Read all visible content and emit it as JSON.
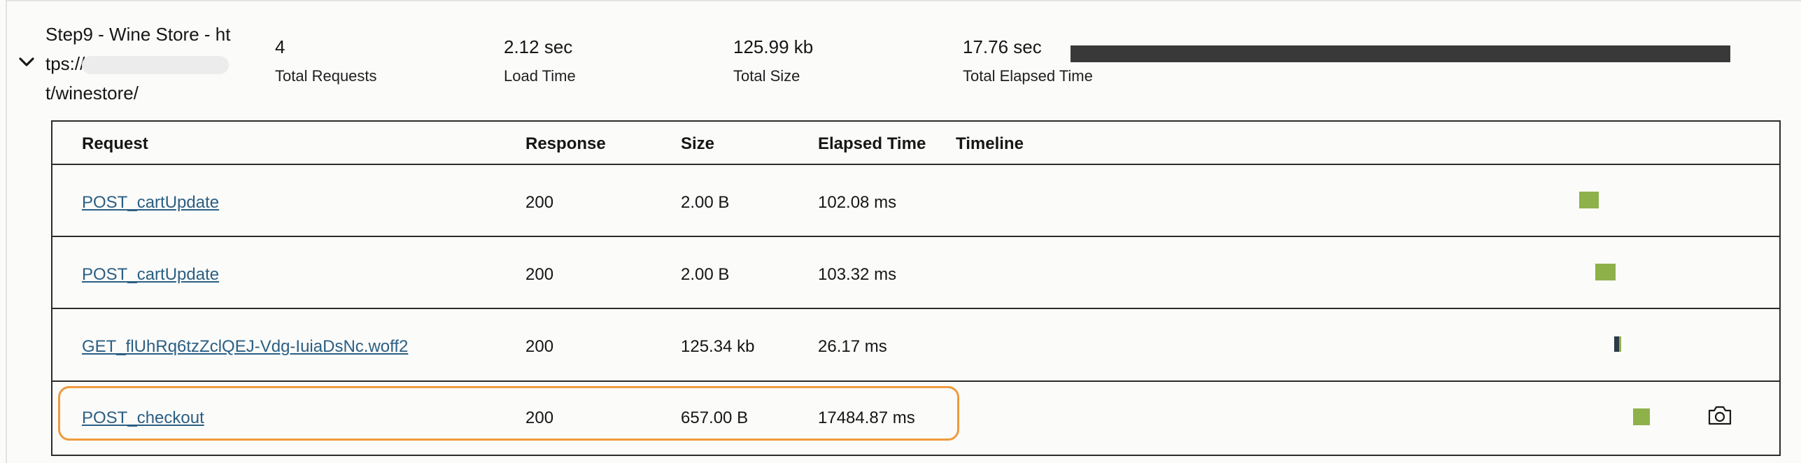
{
  "step": {
    "title_line1": "Step9 - Wine Store - ht",
    "title_line2": "tps://",
    "title_line3": "t/winestore/"
  },
  "stats": [
    {
      "value": "4",
      "label": "Total Requests"
    },
    {
      "value": "2.12 sec",
      "label": "Load Time"
    },
    {
      "value": "125.99 kb",
      "label": "Total Size"
    },
    {
      "value": "17.76 sec",
      "label": "Total Elapsed Time"
    }
  ],
  "summary_bar_color": "#393939",
  "table": {
    "headers": [
      "Request",
      "Response",
      "Size",
      "Elapsed Time",
      "Timeline"
    ],
    "rows": [
      {
        "request": "POST_cartUpdate",
        "response": "200",
        "size": "2.00 B",
        "elapsed": "102.08 ms",
        "timeline_start_fraction": 0.774,
        "timeline_kind": "green"
      },
      {
        "request": "POST_cartUpdate",
        "response": "200",
        "size": "2.00 B",
        "elapsed": "103.32 ms",
        "timeline_start_fraction": 0.782,
        "timeline_kind": "green"
      },
      {
        "request": "GET_flUhRq6tzZclQEJ-Vdg-IuiaDsNc.woff2",
        "response": "200",
        "size": "125.34 kb",
        "elapsed": "26.17 ms",
        "timeline_start_fraction": 0.792,
        "timeline_kind": "split"
      },
      {
        "request": "POST_checkout",
        "response": "200",
        "size": "657.00 B",
        "elapsed": "17484.87 ms",
        "timeline_start_fraction": 0.806,
        "timeline_kind": "green",
        "has_screenshot": true
      }
    ]
  },
  "colors": {
    "link": "#2b5f83",
    "timeline_green": "#8fb14a",
    "highlight_border": "#ef9a3c"
  },
  "icons": {
    "expand": "chevron-down-icon",
    "screenshot": "camera-icon"
  }
}
